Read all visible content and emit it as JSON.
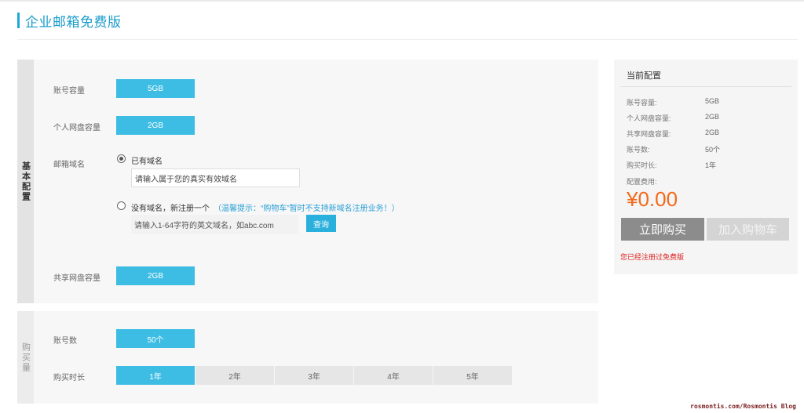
{
  "page": {
    "title": "企业邮箱免费版"
  },
  "basic": {
    "tab_label": "基本配置",
    "account_capacity": {
      "label": "账号容量",
      "value": "5GB"
    },
    "personal_disk": {
      "label": "个人网盘容量",
      "value": "2GB"
    },
    "domain": {
      "label": "邮箱域名",
      "existing_option": "已有域名",
      "existing_placeholder": "请输入属于您的真实有效域名",
      "new_option": "没有域名，新注册一个",
      "tip": "（温馨提示：“购物车”暂时不支持新域名注册业务！）",
      "new_placeholder": "请输入1-64字符的英文域名，如abc.com",
      "query_button": "查询"
    },
    "shared_disk": {
      "label": "共享网盘容量",
      "value": "2GB"
    }
  },
  "purchase": {
    "tab_label": "购买量",
    "accounts": {
      "label": "账号数",
      "value": "50个"
    },
    "duration": {
      "label": "购买时长",
      "options": [
        "1年",
        "2年",
        "3年",
        "4年",
        "5年"
      ],
      "selected": "1年"
    }
  },
  "summary": {
    "title": "当前配置",
    "items": [
      {
        "label": "账号容量:",
        "value": "5GB"
      },
      {
        "label": "个人网盘容量:",
        "value": "2GB"
      },
      {
        "label": "共享网盘容量:",
        "value": "2GB"
      },
      {
        "label": "账号数:",
        "value": "50个"
      },
      {
        "label": "购买时长:",
        "value": "1年"
      }
    ],
    "fee_label": "配置费用:",
    "price": "¥0.00",
    "buy_button": "立即购买",
    "cart_button": "加入购物车",
    "notice": "您已经注册过免费版"
  },
  "watermark": "rosmontis.com/Rosmontis Blog",
  "colors": {
    "accent": "#3dbde4",
    "title": "#1a9ccc",
    "price": "#f26a1b",
    "notice": "#e02020"
  }
}
